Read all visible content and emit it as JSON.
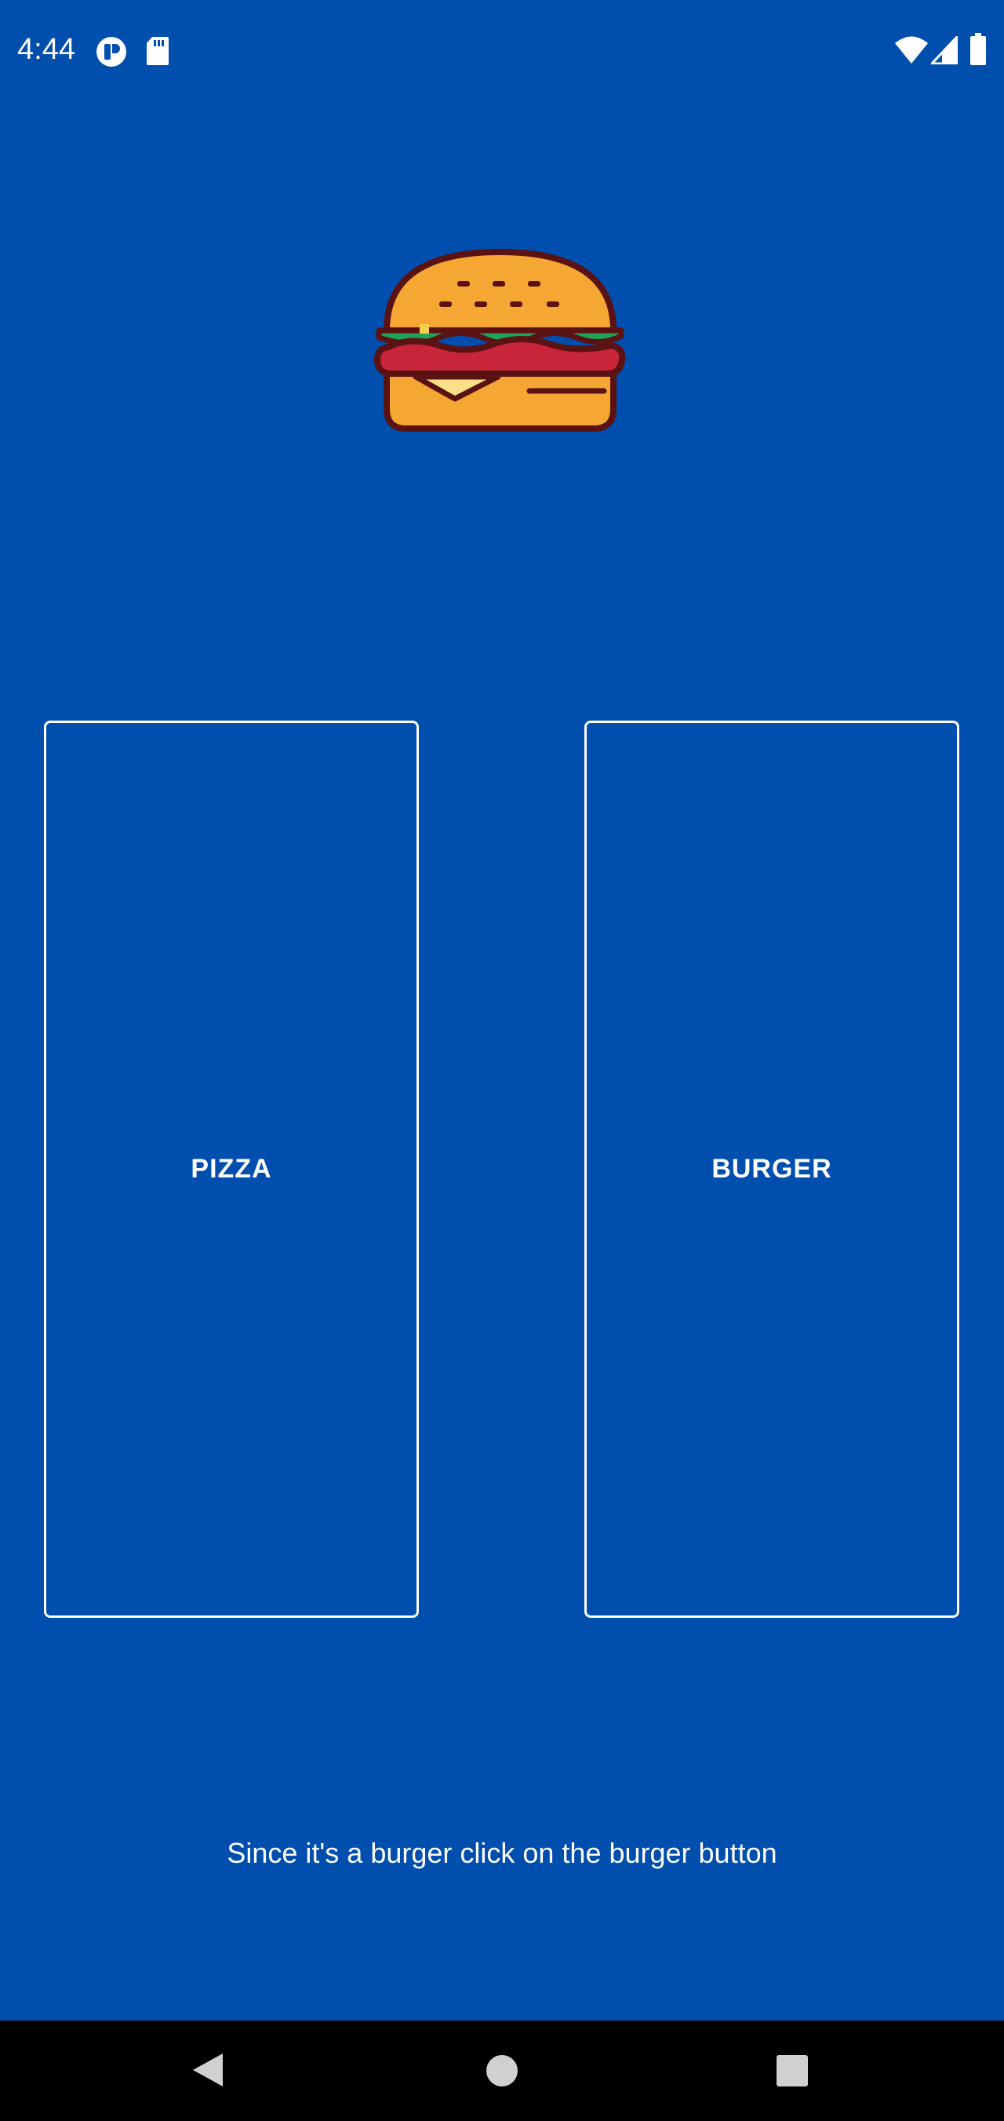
{
  "status_bar": {
    "time": "4:44",
    "icons": [
      "app-notification-icon",
      "sd-card-icon",
      "wifi-icon",
      "cell-signal-icon",
      "battery-icon"
    ]
  },
  "hero": {
    "image_icon": "burger-icon"
  },
  "buttons": {
    "pizza_label": "PIZZA",
    "burger_label": "BURGER"
  },
  "hint": {
    "text": "Since it's a burger click on the burger button"
  },
  "nav_bar": {
    "icons": [
      "back-icon",
      "home-icon",
      "recents-icon"
    ]
  },
  "colors": {
    "background": "#004ead",
    "foreground": "#ffffff",
    "nav_background": "#000000"
  }
}
